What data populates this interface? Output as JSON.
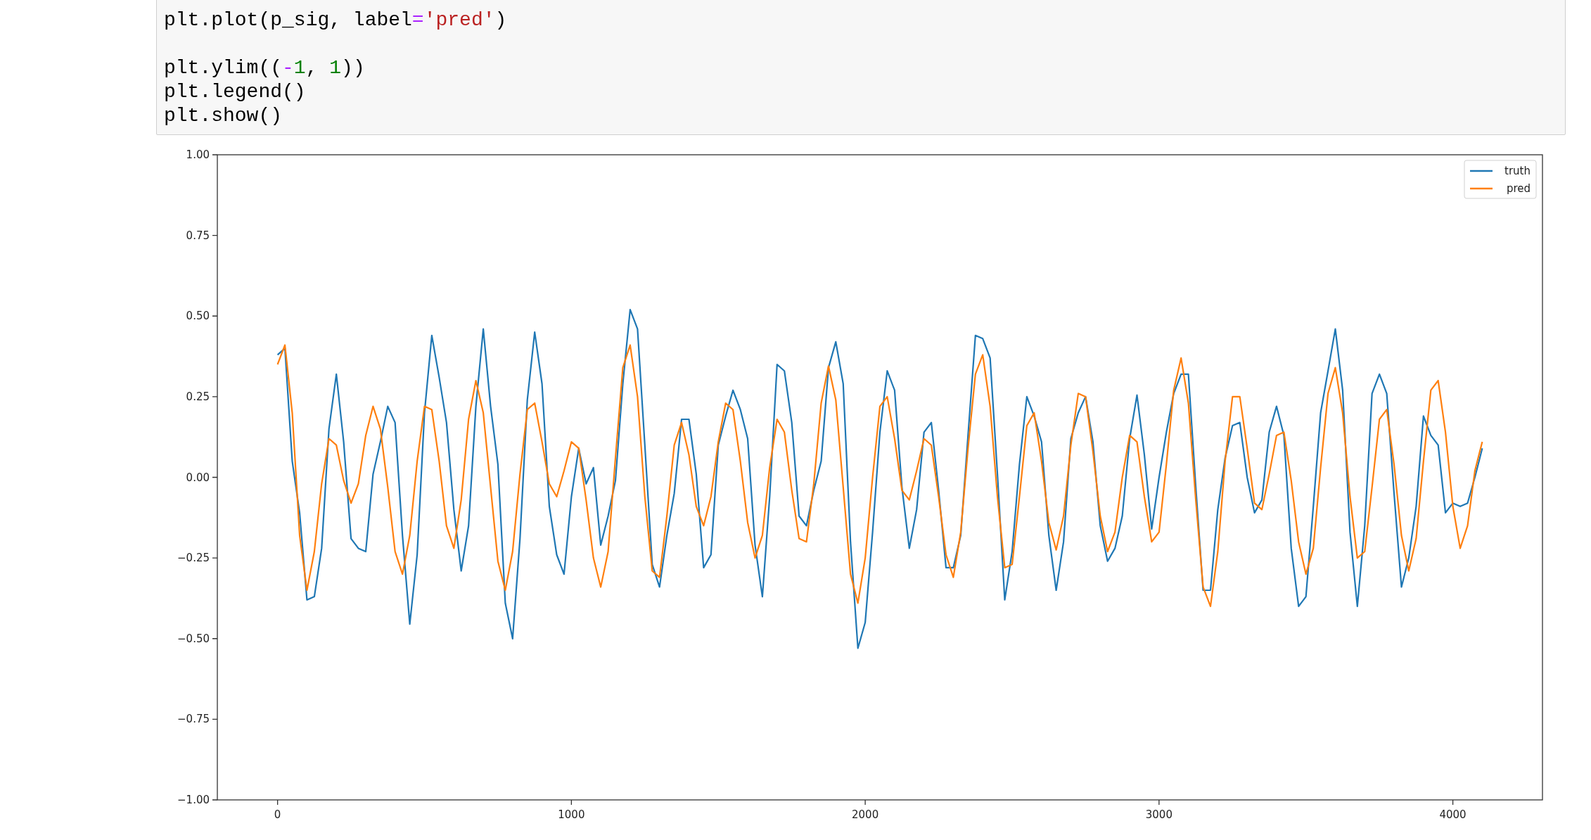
{
  "code_cell": {
    "blocks": [
      [
        "plt.plot(p_sig, label='pred')"
      ],
      [
        "plt.ylim((-1, 1))",
        "plt.legend()",
        "plt.show()"
      ]
    ]
  },
  "output": {
    "chart_data": {
      "type": "line",
      "x": [
        0,
        25,
        50,
        75,
        100,
        125,
        150,
        175,
        200,
        225,
        250,
        275,
        300,
        325,
        350,
        375,
        400,
        425,
        450,
        475,
        500,
        525,
        550,
        575,
        600,
        625,
        650,
        675,
        700,
        725,
        750,
        775,
        800,
        825,
        850,
        875,
        900,
        925,
        950,
        975,
        1000,
        1025,
        1050,
        1075,
        1100,
        1125,
        1150,
        1175,
        1200,
        1225,
        1250,
        1275,
        1300,
        1325,
        1350,
        1375,
        1400,
        1425,
        1450,
        1475,
        1500,
        1525,
        1550,
        1575,
        1600,
        1625,
        1650,
        1675,
        1700,
        1725,
        1750,
        1775,
        1800,
        1825,
        1850,
        1875,
        1900,
        1925,
        1950,
        1975,
        2000,
        2025,
        2050,
        2075,
        2100,
        2125,
        2150,
        2175,
        2200,
        2225,
        2250,
        2275,
        2300,
        2325,
        2350,
        2375,
        2400,
        2425,
        2450,
        2475,
        2500,
        2525,
        2550,
        2575,
        2600,
        2625,
        2650,
        2675,
        2700,
        2725,
        2750,
        2775,
        2800,
        2825,
        2850,
        2875,
        2900,
        2925,
        2950,
        2975,
        3000,
        3025,
        3050,
        3075,
        3100,
        3125,
        3150,
        3175,
        3200,
        3225,
        3250,
        3275,
        3300,
        3325,
        3350,
        3375,
        3400,
        3425,
        3450,
        3475,
        3500,
        3525,
        3550,
        3575,
        3600,
        3625,
        3650,
        3675,
        3700,
        3725,
        3750,
        3775,
        3800,
        3825,
        3850,
        3875,
        3900,
        3925,
        3950,
        3975,
        4000,
        4025,
        4050,
        4075,
        4100
      ],
      "series": [
        {
          "name": "truth",
          "color": "#1f77b4",
          "values": [
            0.38,
            0.4,
            0.05,
            -0.11,
            -0.38,
            -0.37,
            -0.22,
            0.15,
            0.32,
            0.11,
            -0.19,
            -0.22,
            -0.23,
            0.01,
            0.11,
            0.22,
            0.17,
            -0.18,
            -0.455,
            -0.24,
            0.2,
            0.44,
            0.31,
            0.17,
            -0.1,
            -0.29,
            -0.15,
            0.22,
            0.46,
            0.22,
            0.04,
            -0.39,
            -0.5,
            -0.19,
            0.24,
            0.45,
            0.29,
            -0.09,
            -0.24,
            -0.3,
            -0.06,
            0.09,
            -0.02,
            0.03,
            -0.21,
            -0.12,
            -0.01,
            0.29,
            0.52,
            0.46,
            0.1,
            -0.27,
            -0.34,
            -0.18,
            -0.05,
            0.18,
            0.18,
            0.01,
            -0.28,
            -0.24,
            0.1,
            0.19,
            0.27,
            0.21,
            0.12,
            -0.21,
            -0.37,
            -0.06,
            0.35,
            0.33,
            0.17,
            -0.12,
            -0.15,
            -0.04,
            0.05,
            0.34,
            0.42,
            0.29,
            -0.2,
            -0.53,
            -0.45,
            -0.17,
            0.14,
            0.33,
            0.27,
            -0.03,
            -0.22,
            -0.1,
            0.14,
            0.17,
            -0.04,
            -0.28,
            -0.28,
            -0.18,
            0.13,
            0.44,
            0.43,
            0.37,
            0.01,
            -0.38,
            -0.23,
            0.04,
            0.25,
            0.19,
            0.11,
            -0.18,
            -0.35,
            -0.2,
            0.12,
            0.2,
            0.25,
            0.11,
            -0.15,
            -0.26,
            -0.22,
            -0.12,
            0.12,
            0.255,
            0.07,
            -0.16,
            0.0,
            0.14,
            0.26,
            0.32,
            0.32,
            -0.03,
            -0.35,
            -0.35,
            -0.1,
            0.06,
            0.16,
            0.17,
            0.0,
            -0.11,
            -0.07,
            0.14,
            0.22,
            0.13,
            -0.22,
            -0.4,
            -0.37,
            -0.09,
            0.2,
            0.33,
            0.46,
            0.27,
            -0.17,
            -0.4,
            -0.15,
            0.26,
            0.32,
            0.26,
            -0.05,
            -0.34,
            -0.25,
            -0.09,
            0.19,
            0.13,
            0.1,
            -0.11,
            -0.08,
            -0.09,
            -0.08,
            0.0,
            0.09
          ]
        },
        {
          "name": "pred",
          "color": "#ff7f0e",
          "values": [
            0.35,
            0.41,
            0.2,
            -0.18,
            -0.35,
            -0.23,
            -0.02,
            0.12,
            0.1,
            -0.01,
            -0.08,
            -0.02,
            0.13,
            0.22,
            0.15,
            -0.03,
            -0.23,
            -0.3,
            -0.18,
            0.05,
            0.22,
            0.21,
            0.05,
            -0.15,
            -0.22,
            -0.07,
            0.18,
            0.3,
            0.2,
            -0.03,
            -0.26,
            -0.35,
            -0.23,
            0.01,
            0.21,
            0.23,
            0.11,
            -0.02,
            -0.06,
            0.02,
            0.11,
            0.09,
            -0.07,
            -0.25,
            -0.34,
            -0.23,
            0.06,
            0.34,
            0.41,
            0.25,
            -0.06,
            -0.29,
            -0.31,
            -0.12,
            0.1,
            0.17,
            0.07,
            -0.09,
            -0.15,
            -0.06,
            0.11,
            0.23,
            0.21,
            0.05,
            -0.14,
            -0.25,
            -0.18,
            0.03,
            0.18,
            0.14,
            -0.04,
            -0.19,
            -0.2,
            -0.02,
            0.23,
            0.345,
            0.24,
            -0.03,
            -0.3,
            -0.39,
            -0.25,
            0.0,
            0.22,
            0.25,
            0.12,
            -0.04,
            -0.07,
            0.02,
            0.12,
            0.1,
            -0.06,
            -0.24,
            -0.31,
            -0.17,
            0.09,
            0.32,
            0.38,
            0.22,
            -0.06,
            -0.28,
            -0.27,
            -0.06,
            0.16,
            0.2,
            0.05,
            -0.14,
            -0.225,
            -0.12,
            0.1,
            0.26,
            0.25,
            0.08,
            -0.12,
            -0.23,
            -0.17,
            0.0,
            0.13,
            0.11,
            -0.06,
            -0.2,
            -0.17,
            0.04,
            0.27,
            0.37,
            0.23,
            -0.07,
            -0.34,
            -0.4,
            -0.23,
            0.05,
            0.25,
            0.25,
            0.09,
            -0.08,
            -0.1,
            0.01,
            0.13,
            0.14,
            -0.01,
            -0.2,
            -0.3,
            -0.22,
            0.03,
            0.26,
            0.34,
            0.2,
            -0.06,
            -0.25,
            -0.23,
            -0.03,
            0.18,
            0.21,
            0.04,
            -0.18,
            -0.29,
            -0.19,
            0.05,
            0.27,
            0.3,
            0.14,
            -0.09,
            -0.22,
            -0.15,
            0.02,
            0.11
          ]
        }
      ],
      "legend": true,
      "xlim": [
        -205,
        4305
      ],
      "ylim": [
        -1,
        1
      ],
      "xticks": [
        0,
        1000,
        2000,
        3000,
        4000
      ],
      "yticks": [
        {
          "value": -1,
          "label": "−1.00"
        },
        {
          "value": -0.75,
          "label": "−0.75"
        },
        {
          "value": -0.5,
          "label": "−0.50"
        },
        {
          "value": -0.25,
          "label": "−0.25"
        },
        {
          "value": 0,
          "label": "0.00"
        },
        {
          "value": 0.25,
          "label": "0.25"
        },
        {
          "value": 0.5,
          "label": "0.50"
        },
        {
          "value": 0.75,
          "label": "0.75"
        },
        {
          "value": 1,
          "label": "1.00"
        }
      ]
    }
  }
}
